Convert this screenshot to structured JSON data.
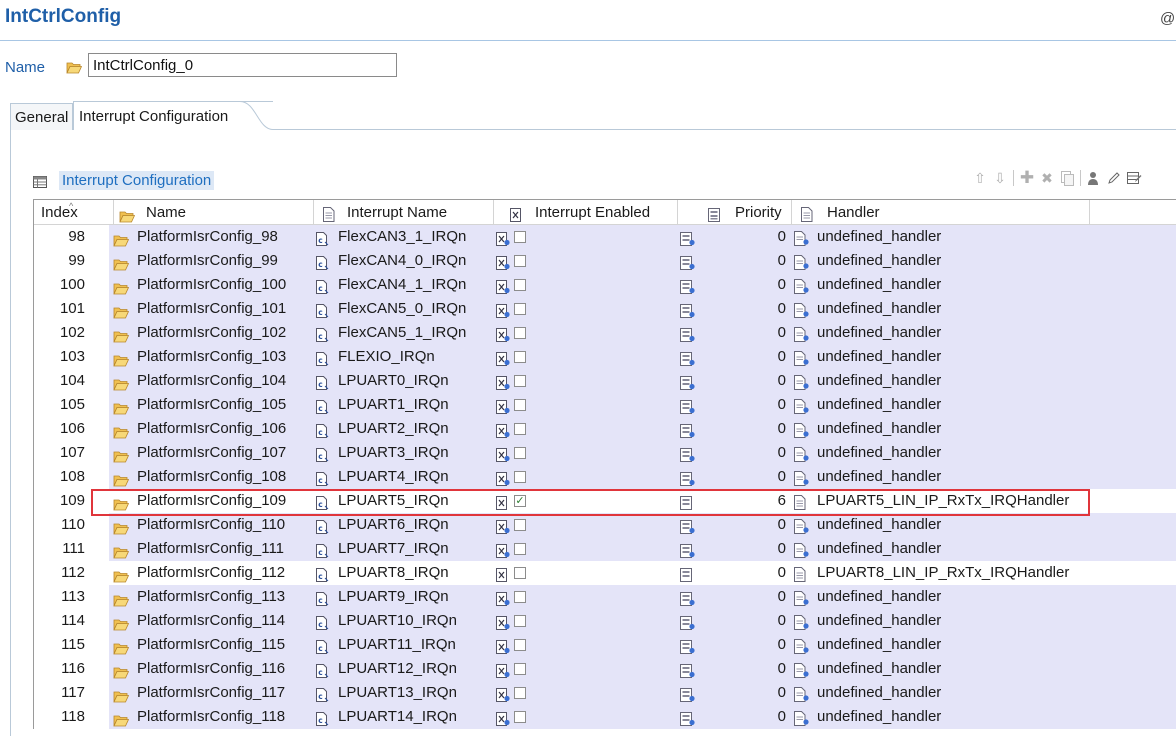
{
  "window": {
    "title": "IntCtrlConfig",
    "right_glyph": "@"
  },
  "name_field": {
    "label": "Name",
    "value": "IntCtrlConfig_0"
  },
  "tabs": [
    {
      "label": "General",
      "active": false
    },
    {
      "label": "Interrupt Configuration",
      "active": true
    }
  ],
  "section": {
    "title": "Interrupt Configuration"
  },
  "toolbar": {
    "icons": [
      "move-up-icon",
      "move-down-icon",
      "add-icon",
      "delete-icon",
      "copy-icon",
      "user-icon",
      "edit-icon",
      "table-edit-icon"
    ]
  },
  "table": {
    "columns": {
      "index": "Index",
      "name": "Name",
      "interrupt_name": "Interrupt Name",
      "interrupt_enabled": "Interrupt Enabled",
      "priority": "Priority",
      "handler": "Handler"
    },
    "rows": [
      {
        "index": "98",
        "name": "PlatformIsrConfig_98",
        "irq": "FlexCAN3_1_IRQn",
        "enabled": false,
        "priority": "0",
        "handler": "undefined_handler"
      },
      {
        "index": "99",
        "name": "PlatformIsrConfig_99",
        "irq": "FlexCAN4_0_IRQn",
        "enabled": false,
        "priority": "0",
        "handler": "undefined_handler"
      },
      {
        "index": "100",
        "name": "PlatformIsrConfig_100",
        "irq": "FlexCAN4_1_IRQn",
        "enabled": false,
        "priority": "0",
        "handler": "undefined_handler"
      },
      {
        "index": "101",
        "name": "PlatformIsrConfig_101",
        "irq": "FlexCAN5_0_IRQn",
        "enabled": false,
        "priority": "0",
        "handler": "undefined_handler"
      },
      {
        "index": "102",
        "name": "PlatformIsrConfig_102",
        "irq": "FlexCAN5_1_IRQn",
        "enabled": false,
        "priority": "0",
        "handler": "undefined_handler"
      },
      {
        "index": "103",
        "name": "PlatformIsrConfig_103",
        "irq": "FLEXIO_IRQn",
        "enabled": false,
        "priority": "0",
        "handler": "undefined_handler"
      },
      {
        "index": "104",
        "name": "PlatformIsrConfig_104",
        "irq": "LPUART0_IRQn",
        "enabled": false,
        "priority": "0",
        "handler": "undefined_handler"
      },
      {
        "index": "105",
        "name": "PlatformIsrConfig_105",
        "irq": "LPUART1_IRQn",
        "enabled": false,
        "priority": "0",
        "handler": "undefined_handler"
      },
      {
        "index": "106",
        "name": "PlatformIsrConfig_106",
        "irq": "LPUART2_IRQn",
        "enabled": false,
        "priority": "0",
        "handler": "undefined_handler"
      },
      {
        "index": "107",
        "name": "PlatformIsrConfig_107",
        "irq": "LPUART3_IRQn",
        "enabled": false,
        "priority": "0",
        "handler": "undefined_handler"
      },
      {
        "index": "108",
        "name": "PlatformIsrConfig_108",
        "irq": "LPUART4_IRQn",
        "enabled": false,
        "priority": "0",
        "handler": "undefined_handler"
      },
      {
        "index": "109",
        "name": "PlatformIsrConfig_109",
        "irq": "LPUART5_IRQn",
        "enabled": true,
        "priority": "6",
        "handler": "LPUART5_LIN_IP_RxTx_IRQHandler",
        "highlighted": true
      },
      {
        "index": "110",
        "name": "PlatformIsrConfig_110",
        "irq": "LPUART6_IRQn",
        "enabled": false,
        "priority": "0",
        "handler": "undefined_handler"
      },
      {
        "index": "111",
        "name": "PlatformIsrConfig_111",
        "irq": "LPUART7_IRQn",
        "enabled": false,
        "priority": "0",
        "handler": "undefined_handler"
      },
      {
        "index": "112",
        "name": "PlatformIsrConfig_112",
        "irq": "LPUART8_IRQn",
        "enabled": false,
        "priority": "0",
        "handler": "LPUART8_LIN_IP_RxTx_IRQHandler",
        "custom": true
      },
      {
        "index": "113",
        "name": "PlatformIsrConfig_113",
        "irq": "LPUART9_IRQn",
        "enabled": false,
        "priority": "0",
        "handler": "undefined_handler"
      },
      {
        "index": "114",
        "name": "PlatformIsrConfig_114",
        "irq": "LPUART10_IRQn",
        "enabled": false,
        "priority": "0",
        "handler": "undefined_handler"
      },
      {
        "index": "115",
        "name": "PlatformIsrConfig_115",
        "irq": "LPUART11_IRQn",
        "enabled": false,
        "priority": "0",
        "handler": "undefined_handler"
      },
      {
        "index": "116",
        "name": "PlatformIsrConfig_116",
        "irq": "LPUART12_IRQn",
        "enabled": false,
        "priority": "0",
        "handler": "undefined_handler"
      },
      {
        "index": "117",
        "name": "PlatformIsrConfig_117",
        "irq": "LPUART13_IRQn",
        "enabled": false,
        "priority": "0",
        "handler": "undefined_handler"
      },
      {
        "index": "118",
        "name": "PlatformIsrConfig_118",
        "irq": "LPUART14_IRQn",
        "enabled": false,
        "priority": "0",
        "handler": "undefined_handler"
      }
    ]
  },
  "colors": {
    "title": "#1f5fa8",
    "default_row_shade": "#e4e4f8",
    "highlight_border": "#e0353b",
    "checkmark": "#2e7d32"
  }
}
